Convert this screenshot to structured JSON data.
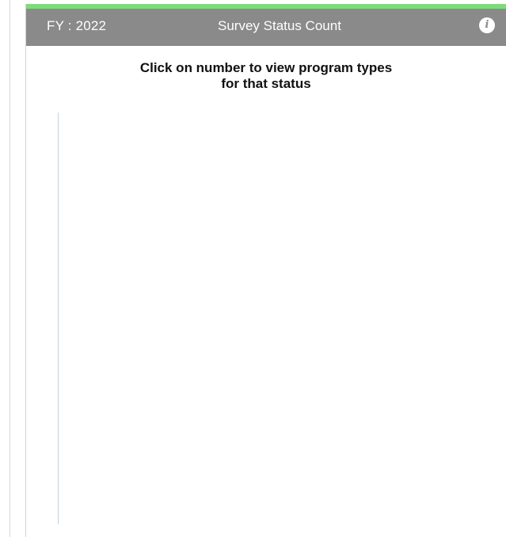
{
  "header": {
    "fy_label": "FY : 2022",
    "title": "Survey Status Count",
    "info_icon": "info-icon"
  },
  "instruction": {
    "line1": "Click on number to view program types",
    "line2": "for that status"
  },
  "colors": {
    "accent": "#7ddc7a",
    "header_bg": "#8a8a8a",
    "axis": "#c4d2de"
  }
}
